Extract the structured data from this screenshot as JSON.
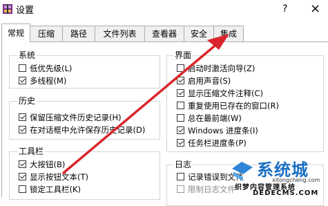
{
  "window": {
    "title": "设置",
    "help_glyph": "?",
    "close_glyph": "×",
    "icon": "archive-app-icon"
  },
  "tabs": [
    {
      "label": "常规",
      "active": true
    },
    {
      "label": "压缩",
      "active": false
    },
    {
      "label": "路径",
      "active": false
    },
    {
      "label": "文件列表",
      "active": false
    },
    {
      "label": "查看器",
      "active": false
    },
    {
      "label": "安全",
      "active": false
    },
    {
      "label": "集成",
      "active": false
    }
  ],
  "groups": {
    "system": {
      "label": "系统",
      "options": [
        {
          "label": "低优先级(L)",
          "checked": false
        },
        {
          "label": "多线程(M)",
          "checked": true
        }
      ]
    },
    "history": {
      "label": "历史",
      "options": [
        {
          "label": "保留压缩文件历史记录(H)",
          "checked": true
        },
        {
          "label": "在对话框中允许保存历史记录(D)",
          "checked": true
        }
      ]
    },
    "toolbar": {
      "label": "工具栏",
      "options": [
        {
          "label": "大按钮(B)",
          "checked": true
        },
        {
          "label": "显示按钮文本(T)",
          "checked": true
        },
        {
          "label": "锁定工具栏(K)",
          "checked": false
        }
      ]
    },
    "interface": {
      "label": "界面",
      "options": [
        {
          "label": "启动时激活向导(Z)",
          "checked": false
        },
        {
          "label": "启用声音(S)",
          "checked": true
        },
        {
          "label": "显示压缩文件注释(C)",
          "checked": true
        },
        {
          "label": "重复使用已存在的窗口(R)",
          "checked": false
        },
        {
          "label": "总在最前端(W)",
          "checked": false
        },
        {
          "label": "Windows 进度条(I)",
          "checked": true
        },
        {
          "label": "任务栏进度条(P)",
          "checked": true
        }
      ]
    },
    "log": {
      "label": "日志",
      "options": [
        {
          "label": "记录错误到文件",
          "checked": false,
          "disabled": false
        },
        {
          "label": "限制日志文件",
          "checked": false,
          "disabled": true
        }
      ]
    }
  },
  "annotation": {
    "color": "#d9252b"
  },
  "watermark": {
    "brand": "系统城",
    "small": "xitongcheng.com",
    "cn": "织梦内容管理系统",
    "en": "DEDECMS.COM",
    "color": "#1a6fc2"
  }
}
